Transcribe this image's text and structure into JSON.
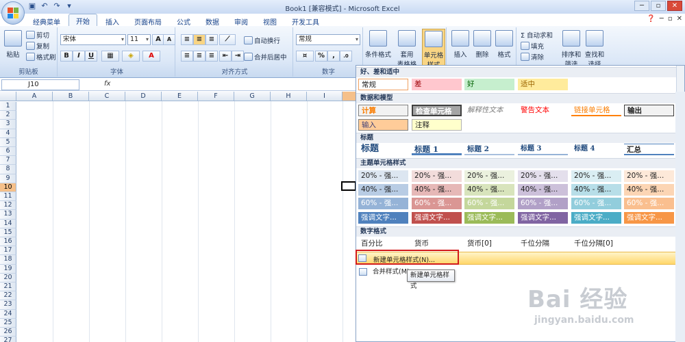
{
  "window": {
    "title": "Book1 [兼容模式] - Microsoft Excel"
  },
  "window_controls": {
    "minimize": "─",
    "restore": "▫",
    "close": "✕"
  },
  "tabs": [
    "经典菜单",
    "开始",
    "插入",
    "页面布局",
    "公式",
    "数据",
    "审阅",
    "视图",
    "开发工具"
  ],
  "active_tab": "开始",
  "clipboard": {
    "paste": "粘贴",
    "cut": "剪切",
    "copy": "复制",
    "format_painter": "格式刷",
    "label": "剪贴板"
  },
  "font": {
    "name": "宋体",
    "size": "11",
    "grow": "A",
    "shrink": "A",
    "bold": "B",
    "italic": "I",
    "underline": "U",
    "label": "字体"
  },
  "alignment": {
    "wrap": "自动换行",
    "merge": "合并后居中",
    "label": "对齐方式"
  },
  "number": {
    "format": "常规",
    "percent": "%",
    "comma": ",",
    "label": "数字"
  },
  "styles": {
    "conditional": "条件格式",
    "table": "套用\n表格格式",
    "cellstyle": "单元格\n样式"
  },
  "cells": {
    "insert": "插入",
    "delete": "删除",
    "format": "格式"
  },
  "editing": {
    "autosum": "Σ 自动求和",
    "fill": "填充",
    "clear": "清除",
    "sort": "排序和\n筛选",
    "find": "查找和\n选择"
  },
  "formula_bar": {
    "name_box": "J10",
    "fx": "fx"
  },
  "columns": [
    "A",
    "B",
    "C",
    "D",
    "E",
    "F",
    "G",
    "H",
    "I"
  ],
  "rows": [
    "1",
    "2",
    "3",
    "4",
    "5",
    "6",
    "7",
    "8",
    "9",
    "10",
    "11",
    "12",
    "13",
    "14",
    "15",
    "16",
    "17",
    "18",
    "19",
    "20",
    "21",
    "22",
    "23",
    "24",
    "25",
    "26",
    "27"
  ],
  "gallery": {
    "sections": {
      "good_bad": "好、差和适中",
      "data_model": "数据和模型",
      "titles": "标题",
      "theme": "主题单元格样式",
      "number": "数字格式"
    },
    "good_bad": [
      "常规",
      "差",
      "好",
      "适中"
    ],
    "data_model_row1": [
      "计算",
      "检查单元格",
      "解释性文本",
      "警告文本",
      "链接单元格",
      "输出"
    ],
    "data_model_row2": [
      "输入",
      "注释"
    ],
    "titles": [
      "标题",
      "标题 1",
      "标题 2",
      "标题 3",
      "标题 4",
      "汇总"
    ],
    "theme_row1": [
      "20% - 强...",
      "20% - 强...",
      "20% - 强...",
      "20% - 强...",
      "20% - 强...",
      "20% - 强..."
    ],
    "theme_row2": [
      "40% - 强...",
      "40% - 强...",
      "40% - 强...",
      "40% - 强...",
      "40% - 强...",
      "40% - 强..."
    ],
    "theme_row3": [
      "60% - 强...",
      "60% - 强...",
      "60% - 强...",
      "60% - 强...",
      "60% - 强...",
      "60% - 强..."
    ],
    "theme_row4": [
      "强调文字...",
      "强调文字...",
      "强调文字...",
      "强调文字...",
      "强调文字...",
      "强调文字..."
    ],
    "number_row": [
      "百分比",
      "货币",
      "货币[0]",
      "千位分隔",
      "千位分隔[0]"
    ],
    "new_style": "新建单元格样式(N)...",
    "merge_styles": "合并样式(M)...",
    "tooltip": "新建单元格样式"
  },
  "watermark": {
    "main": "Bai 经验",
    "sub": "jingyan.baidu.com"
  }
}
